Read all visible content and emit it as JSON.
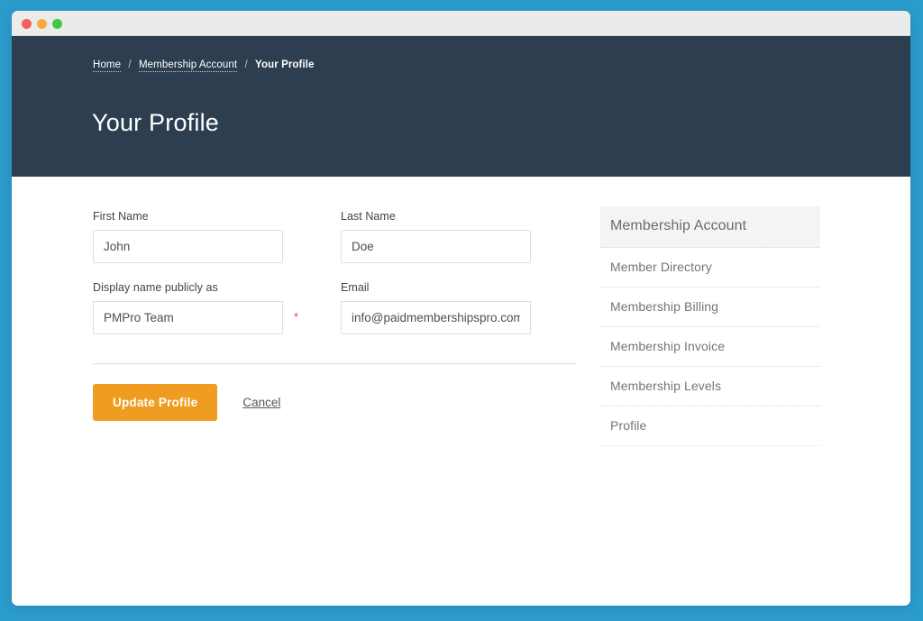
{
  "window": {
    "traffic_lights": [
      {
        "name": "close",
        "color": "#f4615c"
      },
      {
        "name": "minimize",
        "color": "#f6ac3d"
      },
      {
        "name": "zoom",
        "color": "#41c743"
      }
    ]
  },
  "header": {
    "breadcrumb": {
      "items": [
        {
          "label": "Home",
          "is_link": true
        },
        {
          "label": "Membership Account",
          "is_link": true
        },
        {
          "label": "Your Profile",
          "is_link": false
        }
      ],
      "separator": "/"
    },
    "title": "Your Profile",
    "background_color": "#2d3e50"
  },
  "form": {
    "fields": [
      {
        "label": "First Name",
        "value": "John",
        "placeholder": "First Name",
        "required": false
      },
      {
        "label": "Last Name",
        "value": "Doe",
        "placeholder": "Last Name",
        "required": false
      },
      {
        "label": "Display name publicly as",
        "value": "PMPro Team",
        "placeholder": "Display name publicly as",
        "required": true,
        "required_marker": "*"
      },
      {
        "label": "Email",
        "value": "info@paidmembershipspro.com",
        "placeholder": "Email",
        "required": false
      }
    ],
    "submit_label": "Update Profile",
    "cancel_label": "Cancel",
    "accent_color": "#ef9c20",
    "required_color": "#e8473f"
  },
  "sidebar": {
    "header": "Membership Account",
    "items": [
      {
        "label": "Member Directory"
      },
      {
        "label": "Membership Billing"
      },
      {
        "label": "Membership Invoice"
      },
      {
        "label": "Membership Levels"
      },
      {
        "label": "Profile"
      }
    ]
  },
  "theme": {
    "page_background": "#2b9bcc",
    "titlebar": "#ebebeb"
  }
}
